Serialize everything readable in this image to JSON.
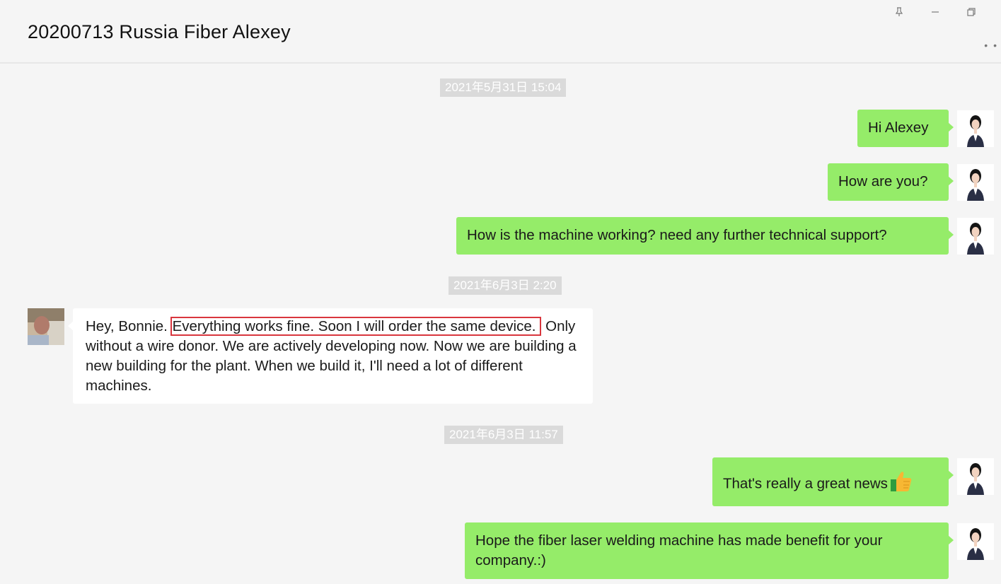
{
  "window": {
    "title": "20200713 Russia Fiber Alexey",
    "more_label": "• •"
  },
  "messages": [
    {
      "type": "timestamp",
      "text": "2021年5月31日 15:04"
    },
    {
      "type": "sent",
      "text": "Hi Alexey"
    },
    {
      "type": "sent",
      "text": "How are you?"
    },
    {
      "type": "sent",
      "text": "How is the machine working? need any further technical support?"
    },
    {
      "type": "timestamp",
      "text": "2021年6月3日 2:20"
    },
    {
      "type": "received",
      "prefix": "Hey, Bonnie. ",
      "highlight": "Everything works fine. Soon I will order the same device.",
      "rest": "Only without a wire donor. We are actively developing now. Now we are building a new building for the plant. When we build it, I'll need a lot of different machines."
    },
    {
      "type": "timestamp",
      "text": "2021年6月3日 11:57"
    },
    {
      "type": "sent",
      "text": "That's really a great news",
      "emoji": "thumbs-up"
    },
    {
      "type": "sent",
      "text": "Hope the fiber laser welding machine has made benefit for your company.:)"
    }
  ],
  "colors": {
    "sent_bubble": "#95ec69",
    "received_bubble": "#ffffff",
    "highlight_border": "#d9363e",
    "timestamp_bg": "#dadada"
  },
  "icons": [
    "pin-icon",
    "minimize-icon",
    "restore-icon",
    "more-icon",
    "thumbs-up-icon"
  ]
}
